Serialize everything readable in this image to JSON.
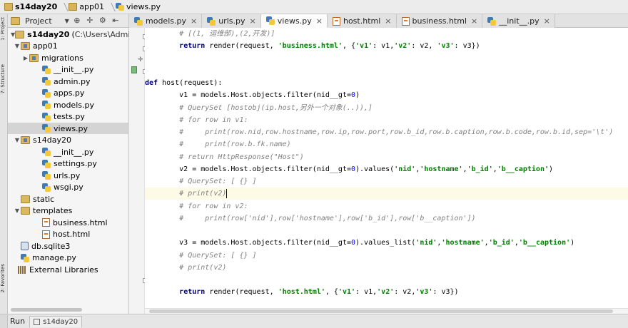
{
  "breadcrumb": {
    "items": [
      "s14day20",
      "app01",
      "views.py"
    ]
  },
  "tool_strip": {
    "labels": [
      "1: Project",
      "7: Structure",
      "2: Favorites"
    ]
  },
  "project_panel": {
    "title": "Project",
    "tree": [
      {
        "label": "s14day20",
        "path": "C:\\Users\\Administrato",
        "depth": 0,
        "arrow": "▼",
        "icon": "folder",
        "bold": true
      },
      {
        "label": "app01",
        "depth": 1,
        "arrow": "▼",
        "icon": "folder-pkg"
      },
      {
        "label": "migrations",
        "depth": 2,
        "arrow": "▶",
        "icon": "folder-pkg"
      },
      {
        "label": "__init__.py",
        "depth": 3,
        "arrow": "",
        "icon": "python"
      },
      {
        "label": "admin.py",
        "depth": 3,
        "arrow": "",
        "icon": "python"
      },
      {
        "label": "apps.py",
        "depth": 3,
        "arrow": "",
        "icon": "python"
      },
      {
        "label": "models.py",
        "depth": 3,
        "arrow": "",
        "icon": "python"
      },
      {
        "label": "tests.py",
        "depth": 3,
        "arrow": "",
        "icon": "python"
      },
      {
        "label": "views.py",
        "depth": 3,
        "arrow": "",
        "icon": "python",
        "selected": true
      },
      {
        "label": "s14day20",
        "depth": 1,
        "arrow": "▼",
        "icon": "folder-pkg"
      },
      {
        "label": "__init__.py",
        "depth": 3,
        "arrow": "",
        "icon": "python"
      },
      {
        "label": "settings.py",
        "depth": 3,
        "arrow": "",
        "icon": "python"
      },
      {
        "label": "urls.py",
        "depth": 3,
        "arrow": "",
        "icon": "python"
      },
      {
        "label": "wsgi.py",
        "depth": 3,
        "arrow": "",
        "icon": "python"
      },
      {
        "label": "static",
        "depth": 1,
        "arrow": "",
        "icon": "folder"
      },
      {
        "label": "templates",
        "depth": 1,
        "arrow": "▼",
        "icon": "folder"
      },
      {
        "label": "business.html",
        "depth": 3,
        "arrow": "",
        "icon": "html"
      },
      {
        "label": "host.html",
        "depth": 3,
        "arrow": "",
        "icon": "html"
      },
      {
        "label": "db.sqlite3",
        "depth": 1,
        "arrow": "",
        "icon": "database"
      },
      {
        "label": "manage.py",
        "depth": 1,
        "arrow": "",
        "icon": "python"
      },
      {
        "label": "External Libraries",
        "depth": 0,
        "arrow": "",
        "icon": "library"
      }
    ]
  },
  "tabs": [
    {
      "label": "models.py",
      "icon": "python",
      "active": false
    },
    {
      "label": "urls.py",
      "icon": "python",
      "active": false
    },
    {
      "label": "views.py",
      "icon": "python",
      "active": true
    },
    {
      "label": "host.html",
      "icon": "html",
      "active": false
    },
    {
      "label": "business.html",
      "icon": "html",
      "active": false
    },
    {
      "label": "__init__.py",
      "icon": "python",
      "active": false
    }
  ],
  "editor": {
    "lines": [
      [
        [
          "cm",
          "        # [(1, 运维部),(2,开发)]"
        ]
      ],
      [
        [
          "",
          "        "
        ],
        [
          "kw",
          "return"
        ],
        [
          "",
          " render(request, "
        ],
        [
          "st",
          "'business.html'"
        ],
        [
          "",
          ", {"
        ],
        [
          "st",
          "'v1'"
        ],
        [
          "",
          ": v1,"
        ],
        [
          "st",
          "'v2'"
        ],
        [
          "",
          ": v2, "
        ],
        [
          "st",
          "'v3'"
        ],
        [
          "",
          ": v3})"
        ]
      ],
      [
        [
          "",
          ""
        ]
      ],
      [
        [
          "",
          ""
        ]
      ],
      [
        [
          "kw",
          "def"
        ],
        [
          "",
          " host(request):"
        ]
      ],
      [
        [
          "",
          "        v1 = models.Host.objects.filter(nid__gt="
        ],
        [
          "nm",
          "0"
        ],
        [
          "",
          ")"
        ]
      ],
      [
        [
          "cm",
          "        # QuerySet [hostobj(ip.host,另外一个对象(..)),]"
        ]
      ],
      [
        [
          "cm",
          "        # for row in v1:"
        ]
      ],
      [
        [
          "cm",
          "        #     print(row.nid,row.hostname,row.ip,row.port,row.b_id,row.b.caption,row.b.code,row.b.id,sep='\\t')"
        ]
      ],
      [
        [
          "cm",
          "        #     print(row.b.fk.name)"
        ]
      ],
      [
        [
          "cm",
          "        # return HttpResponse(\"Host\")"
        ]
      ],
      [
        [
          "",
          "        v2 = models.Host.objects.filter(nid__gt="
        ],
        [
          "nm",
          "0"
        ],
        [
          "",
          ").values("
        ],
        [
          "st",
          "'nid'"
        ],
        [
          "",
          ","
        ],
        [
          "st",
          "'hostname'"
        ],
        [
          "",
          ","
        ],
        [
          "st",
          "'b_id'"
        ],
        [
          "",
          ","
        ],
        [
          "st",
          "'b__caption'"
        ],
        [
          "",
          ")"
        ]
      ],
      [
        [
          "cm",
          "        # QuerySet: [ {} ]"
        ]
      ],
      [
        [
          "cm",
          "        # print(v2)"
        ]
      ],
      [
        [
          "cm",
          "        # for row in v2:"
        ]
      ],
      [
        [
          "cm",
          "        #     print(row['nid'],row['hostname'],row['b_id'],row['b__caption'])"
        ]
      ],
      [
        [
          "",
          ""
        ]
      ],
      [
        [
          "",
          "        v3 = models.Host.objects.filter(nid__gt="
        ],
        [
          "nm",
          "0"
        ],
        [
          "",
          ").values_list("
        ],
        [
          "st",
          "'nid'"
        ],
        [
          "",
          ","
        ],
        [
          "st",
          "'hostname'"
        ],
        [
          "",
          ","
        ],
        [
          "st",
          "'b_id'"
        ],
        [
          "",
          ","
        ],
        [
          "st",
          "'b__caption'"
        ],
        [
          "",
          ")"
        ]
      ],
      [
        [
          "cm",
          "        # QuerySet: [ {} ]"
        ]
      ],
      [
        [
          "cm",
          "        # print(v2)"
        ]
      ],
      [
        [
          "",
          ""
        ]
      ],
      [
        [
          "",
          "        "
        ],
        [
          "kw",
          "return"
        ],
        [
          "",
          " render(request, "
        ],
        [
          "st",
          "'host.html'"
        ],
        [
          "",
          ", {"
        ],
        [
          "st",
          "'v1'"
        ],
        [
          "",
          ": v1,"
        ],
        [
          "st",
          "'v2'"
        ],
        [
          "",
          ": v2,"
        ],
        [
          "st",
          "'v3'"
        ],
        [
          "",
          ": v3})"
        ]
      ]
    ],
    "highlighted_line": 13,
    "caret_line": 13
  },
  "statusbar": {
    "run_label": "Run",
    "run_tab": "s14day20"
  },
  "colors": {
    "keyword": "#000080",
    "string": "#008000",
    "comment": "#808080",
    "number": "#0000ff",
    "current_line": "#fdfae6",
    "selection": "#d4d4d4"
  }
}
